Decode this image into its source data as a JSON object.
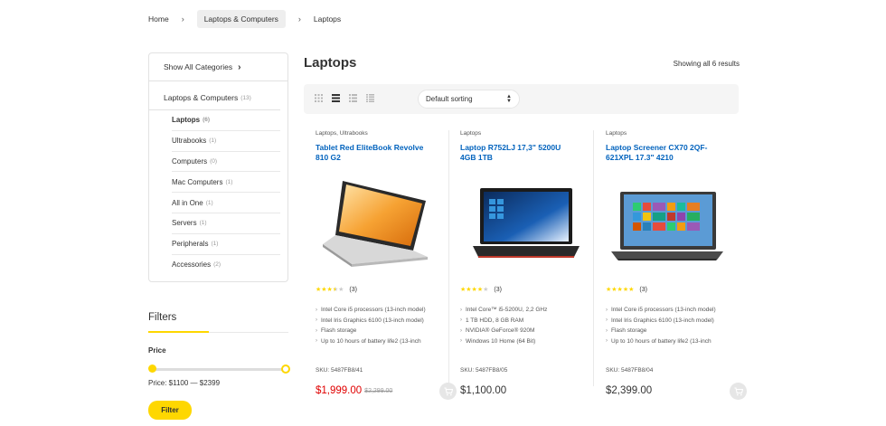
{
  "breadcrumb": {
    "home": "Home",
    "category": "Laptops & Computers",
    "current": "Laptops"
  },
  "sidebar": {
    "show_all": "Show All Categories",
    "parent": {
      "label": "Laptops & Computers",
      "count": "(13)"
    },
    "items": [
      {
        "label": "Laptops",
        "count": "(6)"
      },
      {
        "label": "Ultrabooks",
        "count": "(1)"
      },
      {
        "label": "Computers",
        "count": "(0)"
      },
      {
        "label": "Mac Computers",
        "count": "(1)"
      },
      {
        "label": "All in One",
        "count": "(1)"
      },
      {
        "label": "Servers",
        "count": "(1)"
      },
      {
        "label": "Peripherals",
        "count": "(1)"
      },
      {
        "label": "Accessories",
        "count": "(2)"
      }
    ]
  },
  "filters": {
    "title": "Filters",
    "price_label": "Price",
    "price_range": "Price: $1100 — $2399",
    "button": "Filter",
    "slider_min_fraction": 0.0,
    "slider_max_fraction": 1.0
  },
  "main": {
    "title": "Laptops",
    "result_count": "Showing all 6 results",
    "sort": "Default sorting",
    "view_icons": [
      "grid-view-icon",
      "grid-extended-view-icon",
      "list-view-icon",
      "list-small-view-icon"
    ]
  },
  "products": [
    {
      "category": "Laptops, Ultrabooks",
      "title": "Tablet Red EliteBook Revolve 810 G2",
      "rating": 3.5,
      "rating_count": "(3)",
      "features": [
        "Intel Core i5 processors (13-inch model)",
        "Intel Iris Graphics 6100 (13-inch model)",
        "Flash storage",
        "Up to 10 hours of battery life2 (13-inch"
      ],
      "sku": "SKU: 5487FB8/41",
      "price": "$1,999.00",
      "old_price": "$2,299.00"
    },
    {
      "category": "Laptops",
      "title": "Laptop R752LJ 17,3\" 5200U 4GB 1TB",
      "rating": 4,
      "rating_count": "(3)",
      "features": [
        "Intel Core™ i5-5200U, 2,2 GHz",
        "1 TB HDD, 8 GB RAM",
        "NVIDIA® GeForce® 920M",
        "Windows 10 Home (64 Bit)"
      ],
      "sku": "SKU: 5487FB8/05",
      "price": "$1,100.00",
      "old_price": ""
    },
    {
      "category": "Laptops",
      "title": "Laptop Screener CX70 2QF-621XPL 17.3\" 4210",
      "rating": 5,
      "rating_count": "(3)",
      "features": [
        "Intel Core i5 processors (13-inch model)",
        "Intel Iris Graphics 6100 (13-inch model)",
        "Flash storage",
        "Up to 10 hours of battery life2 (13-inch"
      ],
      "sku": "SKU: 5487FB8/04",
      "price": "$2,399.00",
      "old_price": ""
    }
  ],
  "colors": {
    "accent": "#fed700",
    "link": "#0062bd",
    "sale": "#e00000"
  }
}
